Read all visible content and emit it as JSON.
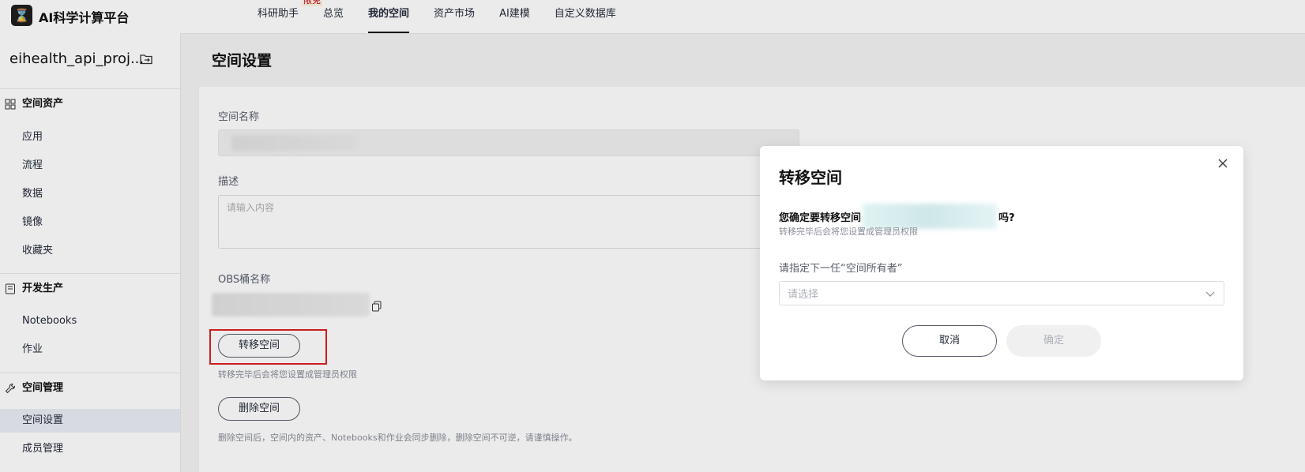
{
  "app": {
    "brand": "AI科学计算平台",
    "logo_glyph": "⌛"
  },
  "topnav": {
    "items": [
      {
        "label": "科研助手",
        "badge": "限免"
      },
      {
        "label": "总览"
      },
      {
        "label": "我的空间",
        "active": true
      },
      {
        "label": "资产市场"
      },
      {
        "label": "AI建模"
      },
      {
        "label": "自定义数据库"
      }
    ]
  },
  "sidebar": {
    "project_name": "eihealth_api_proj...",
    "sections": [
      {
        "title": "空间资产",
        "icon": "grid-icon",
        "items": [
          "应用",
          "流程",
          "数据",
          "镜像",
          "收藏夹"
        ]
      },
      {
        "title": "开发生产",
        "icon": "notebook-icon",
        "items": [
          "Notebooks",
          "作业"
        ]
      },
      {
        "title": "空间管理",
        "icon": "wrench-icon",
        "items": [
          "空间设置",
          "成员管理"
        ],
        "active": "空间设置"
      }
    ]
  },
  "main": {
    "page_title": "空间设置",
    "space_name_label": "空间名称",
    "desc_label": "描述",
    "desc_placeholder": "请输入内容",
    "obs_label": "OBS桶名称",
    "transfer_button": "转移空间",
    "transfer_hint": "转移完毕后会将您设置成管理员权限",
    "delete_button": "删除空间",
    "delete_hint": "删除空间后，空间内的资产、Notebooks和作业会同步删除，删除空间不可逆，请谨慎操作。"
  },
  "dialog": {
    "title": "转移空间",
    "question_prefix": "您确定要转移空间",
    "question_suffix": "吗?",
    "subtext": "转移完毕后会将您设置成管理员权限",
    "owner_label": "请指定下一任“空间所有者”",
    "select_placeholder": "请选择",
    "cancel_label": "取消",
    "confirm_label": "确定"
  },
  "colors": {
    "highlight": "#e02020",
    "active_nav": "#191919",
    "sidebar_active_bg": "#eaeef5"
  }
}
